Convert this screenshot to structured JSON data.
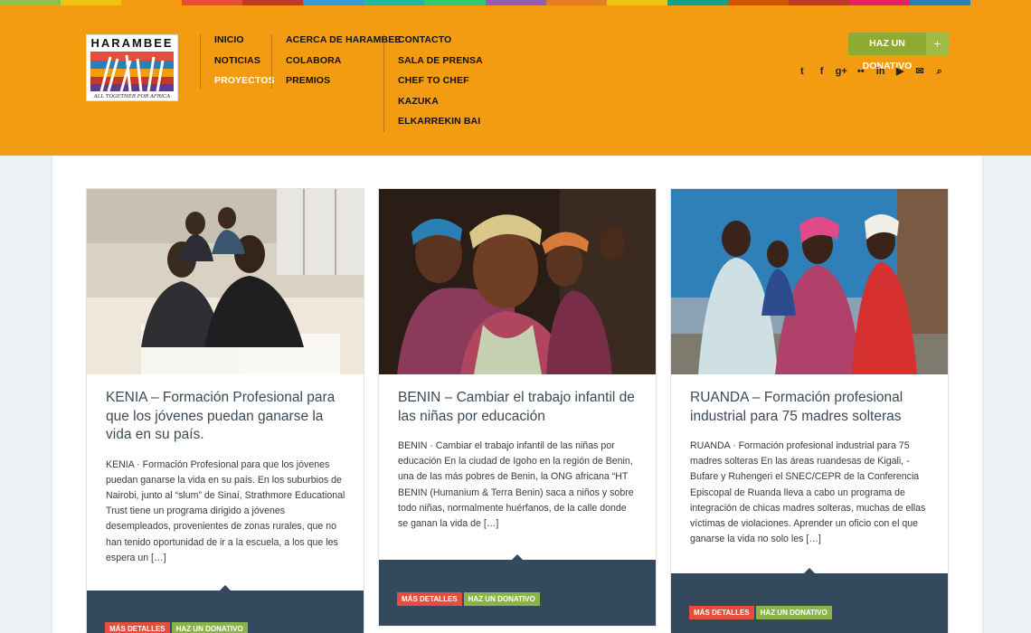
{
  "colors": {
    "header_bg": "#f39c12",
    "donate_green": "#8eaa33",
    "footer_navy": "#34495e",
    "btn_red": "#e74c3c",
    "btn_green": "#8ab34a",
    "rainbow": [
      "#8bc34a",
      "#f1c40f",
      "#f39c12",
      "#e74c3c",
      "#c0392b",
      "#3498db",
      "#1abc9c",
      "#2ecc71",
      "#9b59b6",
      "#e67e22",
      "#f1c40f",
      "#16a085",
      "#d35400",
      "#c0392b",
      "#e91e63",
      "#2980b9",
      "#f39c12"
    ]
  },
  "logo": {
    "title": "HARAMBEE",
    "tagline": "ALL TOGETHER FOR AFRICA"
  },
  "nav": {
    "col1": [
      "INICIO",
      "NOTICIAS",
      "PROYECTOS"
    ],
    "col2": [
      "ACERCA DE HARAMBEE",
      "COLABORA",
      "PREMIOS"
    ],
    "col3": [
      "CONTACTO",
      "SALA DE PRENSA",
      "CHEF TO CHEF",
      "KAZUKA",
      "ELKARREKIN BAI"
    ],
    "active": "PROYECTOS"
  },
  "donate_top": {
    "label": "HAZ UN DONATIVO",
    "plus": "+"
  },
  "social": [
    {
      "name": "twitter-icon",
      "glyph": "t"
    },
    {
      "name": "facebook-icon",
      "glyph": "f"
    },
    {
      "name": "google-plus-icon",
      "glyph": "g+"
    },
    {
      "name": "flickr-icon",
      "glyph": "••"
    },
    {
      "name": "linkedin-icon",
      "glyph": "in"
    },
    {
      "name": "youtube-icon",
      "glyph": "▶"
    },
    {
      "name": "mail-icon",
      "glyph": "✉"
    },
    {
      "name": "search-icon",
      "glyph": "⌕"
    }
  ],
  "cards": [
    {
      "title": "KENIA – Formación Profesional para que los jóvenes puedan ganarse la vida en su país.",
      "excerpt": "KENIA · Formación Profesional para que los jóvenes puedan ganarse la vida en su país. En los suburbios de Nairobi, junto al “slum” de Sinaí, Strathmore Educational Trust tiene un programa dirigido a jóvenes desempleados, provenientes de zonas rurales, que no han tenido oportunidad de ir a la escuela, a los que les espera un […]",
      "btn_more": "MÁS DETALLES",
      "btn_donate": "HAZ UN DONATIVO"
    },
    {
      "title": "BENIN – Cambiar el trabajo infantil de las niñas por educación",
      "excerpt": "BENIN · Cambiar el trabajo infantil de las niñas por educación En la ciudad de Igoho en la región de Benin, una de las más pobres de Benin, la ONG africana “HT BENIN (Humanium & Terra Benin) saca a niños y sobre todo niñas, normalmente huérfanos, de la calle donde se ganan la vida de […]",
      "btn_more": "MÁS DETALLES",
      "btn_donate": "HAZ UN DONATIVO"
    },
    {
      "title": "RUANDA – Formación profesional industrial para 75 madres solteras",
      "excerpt": "RUANDA · Formación profesional industrial para 75 madres solteras En las áreas ruandesas de   Kigali, -Bufare y Ruhengeri el SNEC/CEPR de la Conferencia Episcopal de Ruanda lleva a cabo un programa de integración de chicas madres solteras, muchas de ellas víctimas de violaciones. Aprender un oficio con el que ganarse la vida no solo les […]",
      "btn_more": "MÁS DETALLES",
      "btn_donate": "HAZ UN DONATIVO"
    }
  ]
}
